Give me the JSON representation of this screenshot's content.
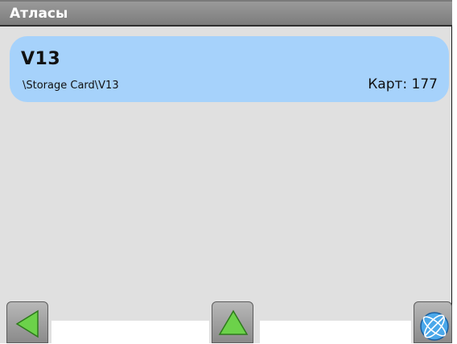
{
  "window": {
    "title": "Атласы"
  },
  "atlases": [
    {
      "name": "V13",
      "path": "\\Storage Card\\V13",
      "count_label": "Карт: 177"
    }
  ],
  "toolbar": {
    "back_icon": "left-arrow-icon",
    "up_icon": "up-arrow-icon",
    "globe_icon": "globe-icon",
    "accent": "#a6d2fb",
    "arrow_color": "#6cd24a"
  }
}
